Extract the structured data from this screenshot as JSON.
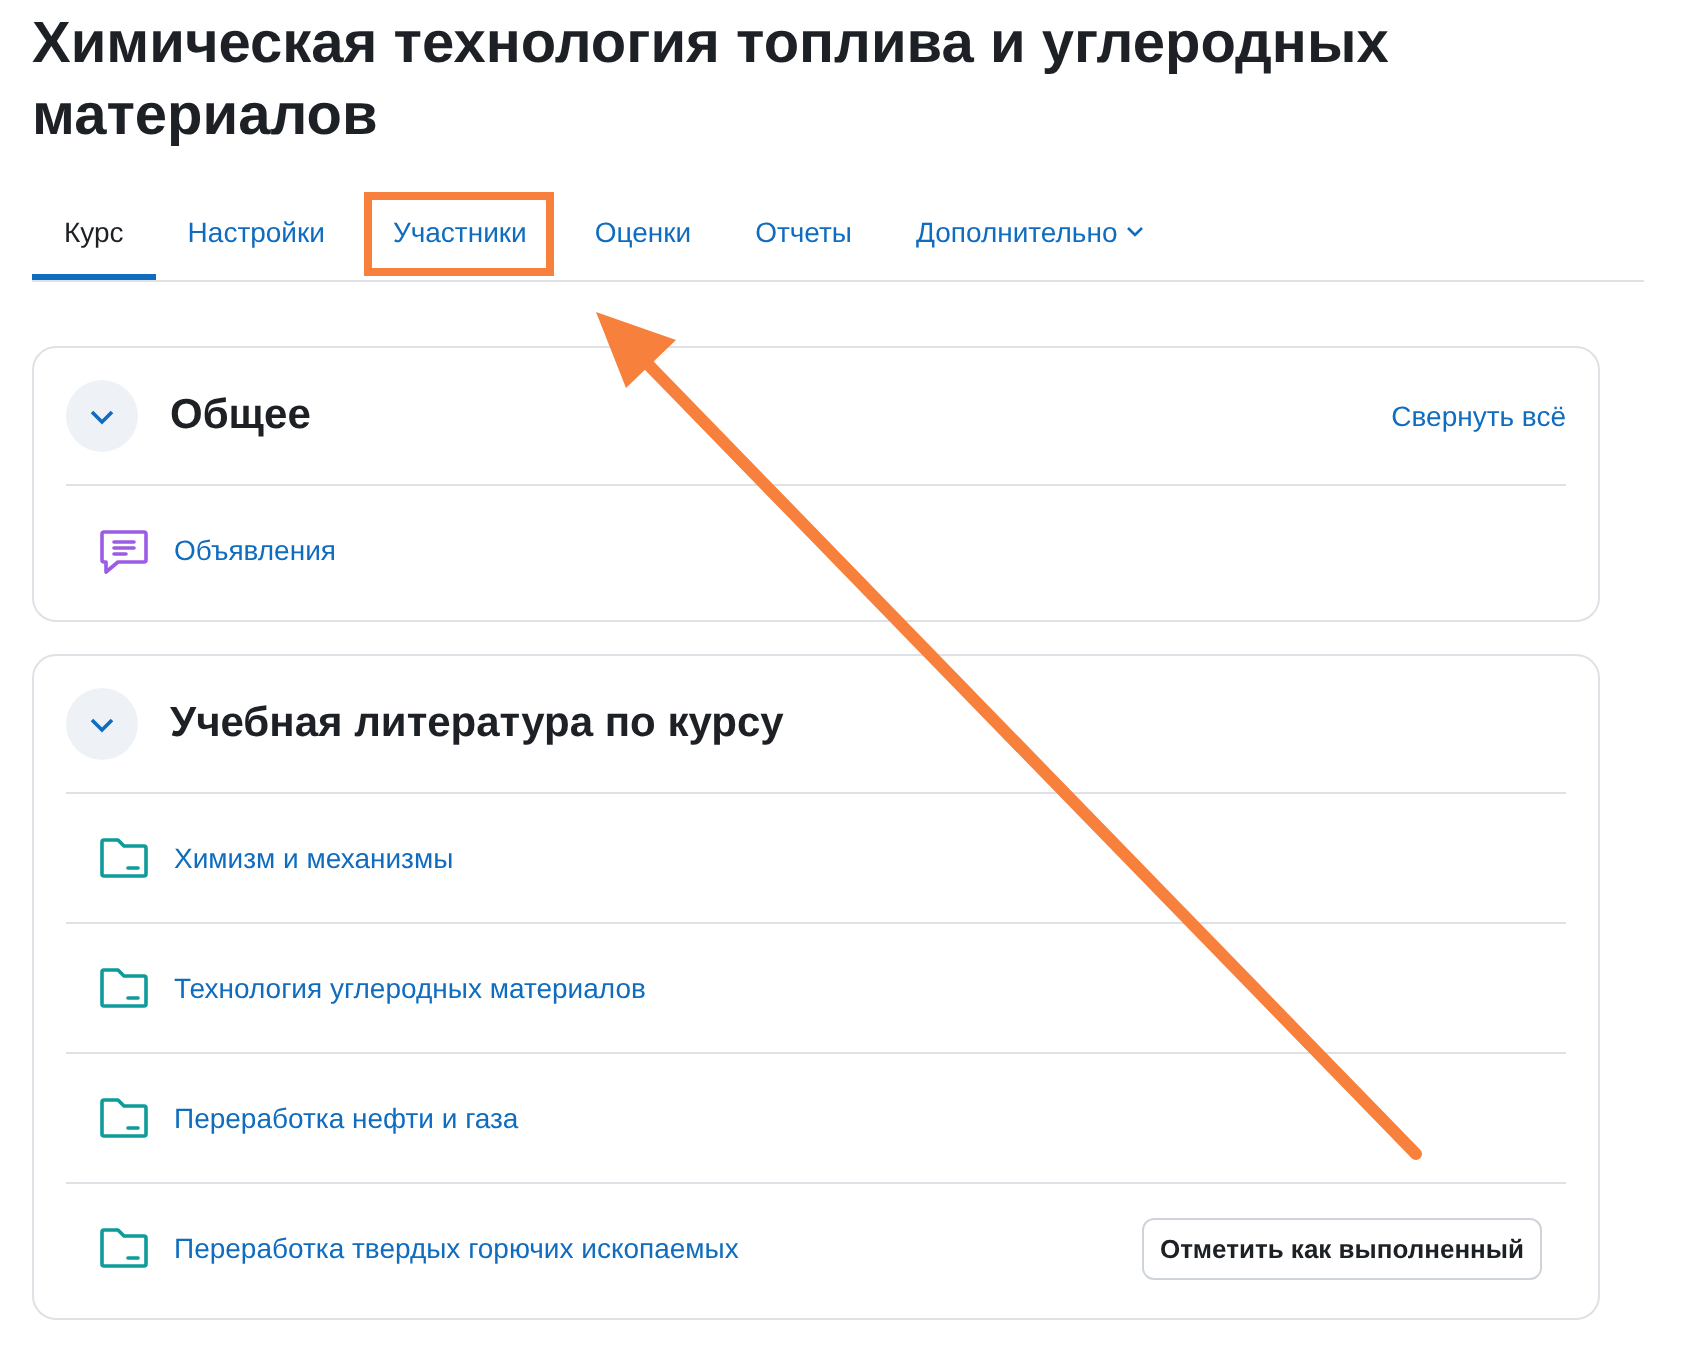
{
  "course_title": "Химическая технология топлива и углеродных материалов",
  "tabs": [
    {
      "label": "Курс",
      "selected": true,
      "highlighted": false
    },
    {
      "label": "Настройки",
      "selected": false,
      "highlighted": false
    },
    {
      "label": "Участники",
      "selected": false,
      "highlighted": true
    },
    {
      "label": "Оценки",
      "selected": false,
      "highlighted": false
    },
    {
      "label": "Отчеты",
      "selected": false,
      "highlighted": false
    },
    {
      "label": "Дополнительно",
      "selected": false,
      "highlighted": false,
      "has_menu": true
    }
  ],
  "sections": [
    {
      "title": "Общее",
      "expanded": true,
      "collapse_all": "Свернуть всё",
      "activities": [
        {
          "kind": "forum",
          "name": "Объявления"
        }
      ]
    },
    {
      "title": "Учебная литература по курсу",
      "expanded": true,
      "activities": [
        {
          "kind": "folder",
          "name": "Химизм и механизмы"
        },
        {
          "kind": "folder",
          "name": "Технология углеродных материалов"
        },
        {
          "kind": "folder",
          "name": "Переработка нефти и газа"
        },
        {
          "kind": "folder",
          "name": "Переработка твердых горючих ископаемых",
          "completion_button": "Отметить как выполненный"
        }
      ]
    }
  ]
}
